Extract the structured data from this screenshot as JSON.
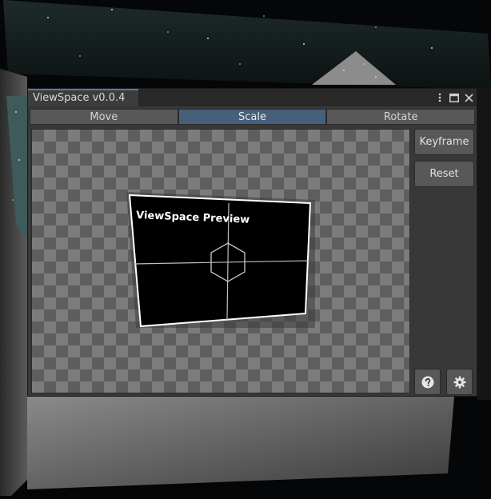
{
  "window": {
    "title": "ViewSpace v0.0.4",
    "controls": [
      "more-vertical-icon",
      "maximize-icon",
      "close-icon"
    ]
  },
  "toolbar": {
    "tabs": [
      {
        "label": "Move",
        "active": false
      },
      {
        "label": "Scale",
        "active": true
      },
      {
        "label": "Rotate",
        "active": false
      }
    ]
  },
  "preview": {
    "overlay_text": "ViewSpace Preview"
  },
  "sidebar": {
    "keyframe_label": "Keyframe",
    "reset_label": "Reset",
    "help_icon": "question-circle-icon",
    "settings_icon": "gear-icon"
  },
  "colors": {
    "active_tab": "#46607c",
    "accent": "#4a7ab8",
    "panel": "#383838",
    "button": "#585858"
  }
}
